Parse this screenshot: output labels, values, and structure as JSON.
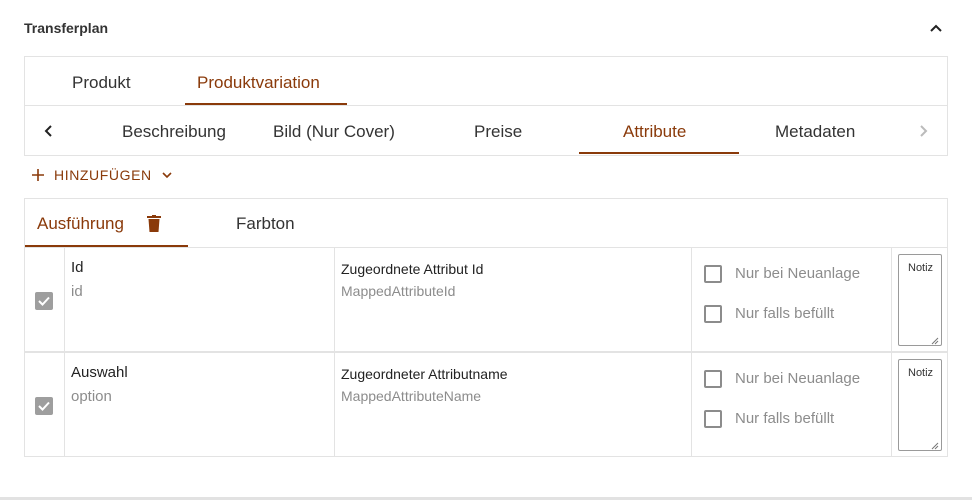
{
  "panel": {
    "title": "Transferplan"
  },
  "main_tabs": [
    {
      "label": "Produkt",
      "active": false
    },
    {
      "label": "Produktvariation",
      "active": true
    }
  ],
  "sub_tabs": [
    {
      "label": "Beschreibung",
      "active": false
    },
    {
      "label": "Bild (Nur Cover)",
      "active": false
    },
    {
      "label": "Preise",
      "active": false
    },
    {
      "label": "Attribute",
      "active": true
    },
    {
      "label": "Metadaten",
      "active": false
    }
  ],
  "add_button": {
    "label": "HINZUFÜGEN"
  },
  "attribute_tabs": [
    {
      "label": "Ausführung",
      "active": true
    },
    {
      "label": "Farbton",
      "active": false
    }
  ],
  "rows": [
    {
      "checked": true,
      "name": "Id",
      "key": "id",
      "mapped_label": "Zugeordnete Attribut Id",
      "mapped_key": "MappedAttributeId",
      "option_new": "Nur bei Neuanlage",
      "option_filled": "Nur falls befüllt",
      "note_placeholder": "Notiz"
    },
    {
      "checked": true,
      "name": "Auswahl",
      "key": "option",
      "mapped_label": "Zugeordneter Attributname",
      "mapped_key": "MappedAttributeName",
      "option_new": "Nur bei Neuanlage",
      "option_filled": "Nur falls befüllt",
      "note_placeholder": "Notiz"
    }
  ],
  "colors": {
    "accent": "#8a3a0a",
    "border": "#e3e3e3",
    "muted_text": "#8c8c8c",
    "checkbox_gray": "#9e9e9e"
  },
  "icons": [
    "chevron-up-icon",
    "chevron-left-icon",
    "chevron-right-icon",
    "plus-icon",
    "chevron-down-icon",
    "trash-icon",
    "check-icon"
  ]
}
